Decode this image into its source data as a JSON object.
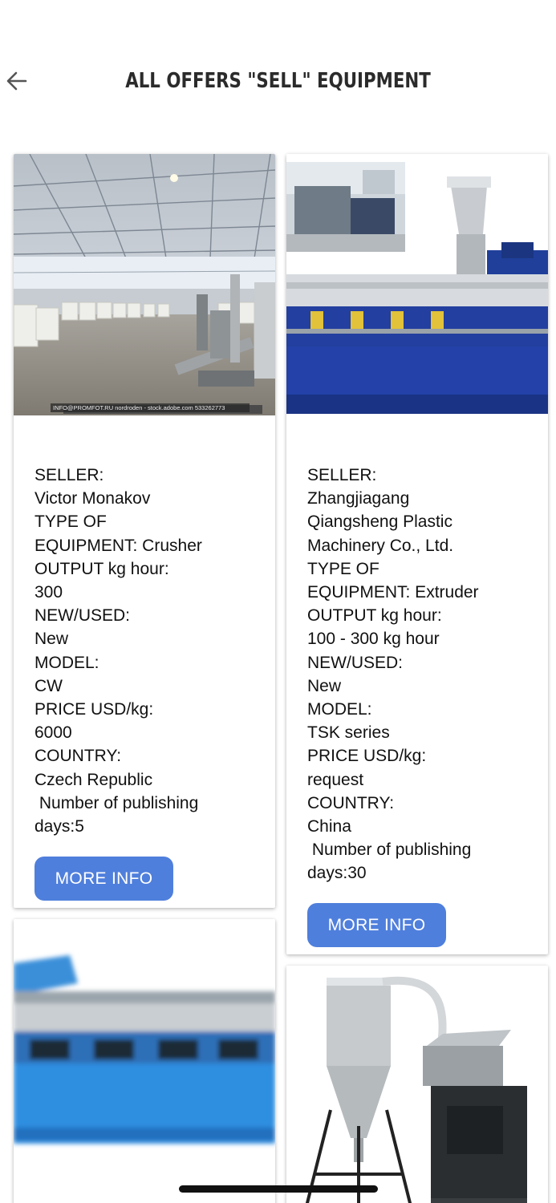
{
  "header": {
    "title": "ALL OFFERS \"SELL\" EQUIPMENT",
    "back_icon": "arrow-left-icon"
  },
  "offers": [
    {
      "lines": [
        "SELLER:",
        "Victor Monakov",
        "TYPE OF",
        "EQUIPMENT: Crusher",
        "OUTPUT kg hour:",
        "300",
        "NEW/USED:",
        "New",
        "MODEL:",
        "CW",
        "PRICE USD/kg:",
        "6000",
        "COUNTRY:",
        "Czech Republic",
        " Number of publishing",
        "days:5"
      ],
      "button_label": "MORE INFO",
      "image_caption": "INFO@PROMFOT.RU nordroden - stock.adobe.com 533262773"
    },
    {
      "lines": [
        "SELLER:",
        "Zhangjiagang",
        "Qiangsheng Plastic",
        "Machinery Co., Ltd.",
        "TYPE OF",
        "EQUIPMENT: Extruder",
        "OUTPUT kg hour:",
        "100 - 300 kg hour",
        "NEW/USED:",
        "New",
        "MODEL:",
        "TSK series",
        "PRICE USD/kg:",
        "request",
        "COUNTRY:",
        "China",
        " Number of publishing",
        "days:30"
      ],
      "button_label": "MORE INFO"
    }
  ]
}
